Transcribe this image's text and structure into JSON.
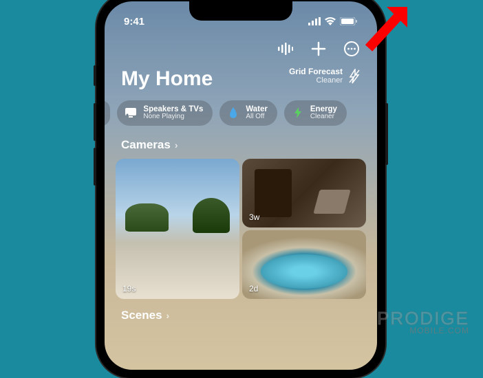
{
  "status": {
    "time": "9:41"
  },
  "header": {
    "title": "My Home",
    "grid_forecast_label": "Grid Forecast",
    "grid_forecast_value": "Cleaner"
  },
  "pills": [
    {
      "title": "y",
      "sub": ""
    },
    {
      "title": "Speakers & TVs",
      "sub": "None Playing"
    },
    {
      "title": "Water",
      "sub": "All Off"
    },
    {
      "title": "Energy",
      "sub": "Cleaner"
    }
  ],
  "sections": {
    "cameras": "Cameras",
    "scenes": "Scenes"
  },
  "cameras": [
    {
      "ts": "19s"
    },
    {
      "ts": "3w"
    },
    {
      "ts": "2d"
    }
  ],
  "watermark": {
    "main": "PRODIGE",
    "sub": "MOBILE.COM"
  }
}
